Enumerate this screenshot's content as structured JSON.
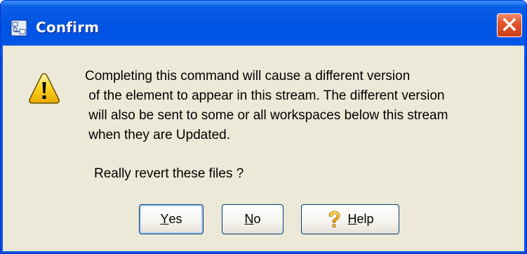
{
  "window": {
    "title": "Confirm",
    "app_icon": "app-icon",
    "close_icon": "close-icon"
  },
  "dialog": {
    "icon": "warning-icon",
    "message_lines": [
      "Completing this command will cause a different version",
      " of the element to appear in this stream. The different version",
      " will also be sent to some or all workspaces below this stream",
      " when they are Updated."
    ],
    "question": "Really revert these files ?"
  },
  "buttons": {
    "yes": {
      "accel": "Y",
      "rest": "es"
    },
    "no": {
      "accel": "N",
      "rest": "o"
    },
    "help": {
      "accel": "H",
      "rest": "elp",
      "icon": "question-mark-icon"
    }
  },
  "colors": {
    "titlebar": "#0054e3",
    "close_button": "#e2572f",
    "dialog_background": "#ece9d8",
    "warning_yellow": "#ffd21e"
  }
}
